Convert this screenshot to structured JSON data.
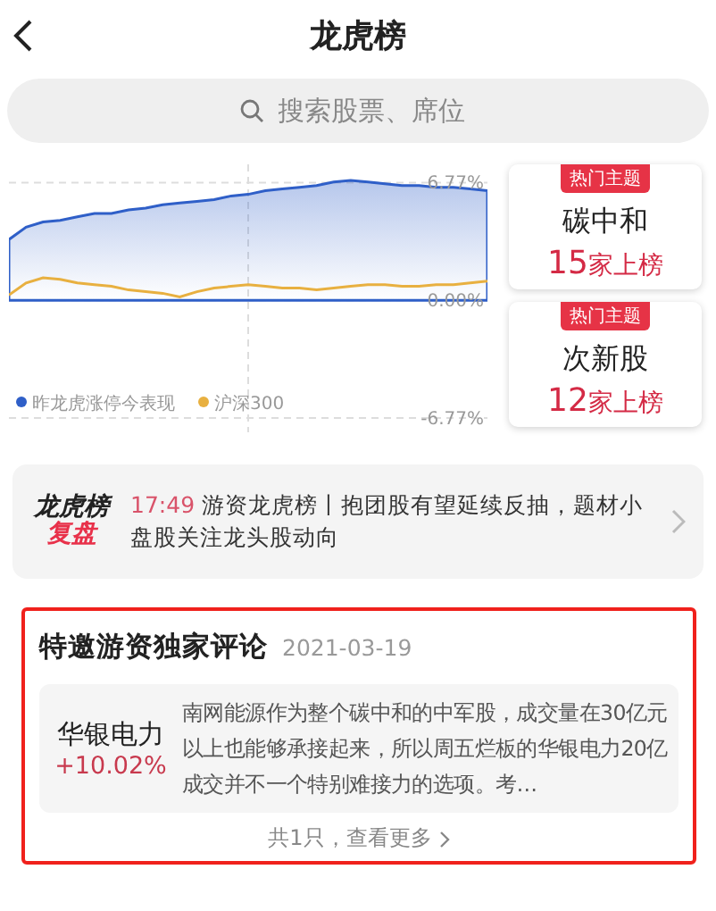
{
  "header": {
    "title": "龙虎榜"
  },
  "search": {
    "placeholder": "搜索股票、席位"
  },
  "chart": {
    "chart_data": {
      "type": "line",
      "yticks": [
        {
          "value": -6.77,
          "label": "-6.77%"
        },
        {
          "value": 0,
          "label": "0.00%"
        },
        {
          "value": 6.77,
          "label": "6.77%"
        }
      ],
      "ylim": [
        -6.77,
        7.0
      ],
      "legend": "bottom-left",
      "series": [
        {
          "name": "昨龙虎涨停今表现",
          "color": "#2f5fc8",
          "type": "area",
          "values": [
            3.5,
            4.2,
            4.5,
            4.6,
            4.8,
            5.0,
            5.0,
            5.2,
            5.3,
            5.5,
            5.6,
            5.7,
            5.8,
            6.0,
            6.1,
            6.3,
            6.4,
            6.5,
            6.6,
            6.8,
            6.9,
            6.8,
            6.7,
            6.6,
            6.6,
            6.5,
            6.5,
            6.4,
            6.3
          ]
        },
        {
          "name": "沪深300",
          "color": "#e8b040",
          "type": "line",
          "values": [
            0.3,
            1.0,
            1.3,
            1.2,
            1.0,
            0.9,
            0.8,
            0.6,
            0.5,
            0.4,
            0.2,
            0.5,
            0.7,
            0.8,
            0.9,
            0.8,
            0.7,
            0.7,
            0.6,
            0.7,
            0.8,
            0.9,
            0.9,
            0.8,
            0.8,
            0.9,
            0.9,
            1.0,
            1.1
          ]
        }
      ]
    }
  },
  "themes": [
    {
      "badge": "热门主题",
      "name": "碳中和",
      "count": "15",
      "suffix": "家上榜"
    },
    {
      "badge": "热门主题",
      "name": "次新股",
      "count": "12",
      "suffix": "家上榜"
    }
  ],
  "banner": {
    "logo_top": "龙虎榜",
    "logo_bottom": "复盘",
    "time": "17:49",
    "text": "游资龙虎榜丨抱团股有望延续反抽，题材小盘股关注龙头股动向"
  },
  "comments": {
    "title": "特邀游资独家评论",
    "date": "2021-03-19",
    "items": [
      {
        "stock": "华银电力",
        "change": "+10.02%",
        "text": "南网能源作为整个碳中和的中军股，成交量在30亿元以上也能够承接起来，所以周五烂板的华银电力20亿成交并不一个特别难接力的选项。考…"
      }
    ],
    "more": "共1只，查看更多"
  }
}
